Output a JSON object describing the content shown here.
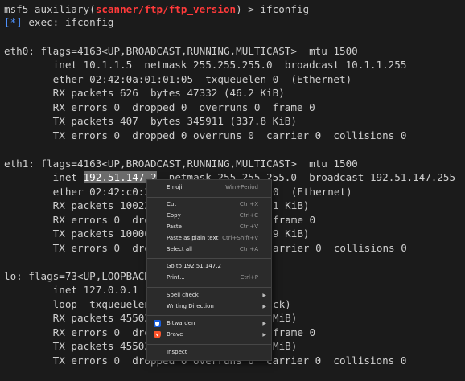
{
  "terminal": {
    "prompt_prefix": "msf5 auxiliary(",
    "module_path": "scanner/ftp/ftp_version",
    "prompt_suffix": ") > ifconfig",
    "exec_marker": "[*]",
    "exec_text": " exec: ifconfig",
    "eth0": {
      "l1": "eth0: flags=4163<UP,BROADCAST,RUNNING,MULTICAST>  mtu 1500",
      "l2": "        inet 10.1.1.5  netmask 255.255.255.0  broadcast 10.1.1.255",
      "l3": "        ether 02:42:0a:01:01:05  txqueuelen 0  (Ethernet)",
      "l4": "        RX packets 626  bytes 47332 (46.2 KiB)",
      "l5": "        RX errors 0  dropped 0  overruns 0  frame 0",
      "l6": "        TX packets 407  bytes 345911 (337.8 KiB)",
      "l7": "        TX errors 0  dropped 0 overruns 0  carrier 0  collisions 0"
    },
    "eth1": {
      "l1": "eth1: flags=4163<UP,BROADCAST,RUNNING,MULTICAST>  mtu 1500",
      "l2_pre": "        inet ",
      "l2_sel": "192.51.147.2",
      "l2_post": "  netmask 255.255.255.0  broadcast 192.51.147.255",
      "l3a": "        ether 02:42:c0:3",
      "l3b": "0  (Ethernet)",
      "l4a": "        RX packets 10022",
      "l4b": "1 KiB)",
      "l5a": "        RX errors 0  dro",
      "l5b": "frame 0",
      "l6a": "        TX packets 10006",
      "l6b": "9 KiB)",
      "l7a": "        TX errors 0  dro",
      "l7b": "arrier 0  collisions 0"
    },
    "lo": {
      "l1": "lo: flags=73<UP,LOOPBACK",
      "l2": "        inet 127.0.0.1",
      "l3a": "        loop  txqueuelen",
      "l3b": "ck)",
      "l4a": "        RX packets 45503",
      "l4b": "MiB)",
      "l5a": "        RX errors 0  dro",
      "l5b": "frame 0",
      "l6a": "        TX packets 45503",
      "l6b": "MiB)",
      "l7": "        TX errors 0  dropped 0 overruns 0  carrier 0  collisions 0"
    }
  },
  "context_menu": {
    "emoji": {
      "label": "Emoji",
      "shortcut": "Win+Period"
    },
    "cut": {
      "label": "Cut",
      "shortcut": "Ctrl+X"
    },
    "copy": {
      "label": "Copy",
      "shortcut": "Ctrl+C"
    },
    "paste": {
      "label": "Paste",
      "shortcut": "Ctrl+V"
    },
    "paste_plain": {
      "label": "Paste as plain text",
      "shortcut": "Ctrl+Shift+V"
    },
    "select_all": {
      "label": "Select all",
      "shortcut": "Ctrl+A"
    },
    "goto": {
      "label": "Go to 192.51.147.2"
    },
    "print": {
      "label": "Print...",
      "shortcut": "Ctrl+P"
    },
    "spell": {
      "label": "Spell check"
    },
    "writing": {
      "label": "Writing Direction"
    },
    "bitwarden": {
      "label": "Bitwarden"
    },
    "brave": {
      "label": "Brave"
    },
    "inspect": {
      "label": "Inspect"
    }
  },
  "icons": {
    "submenu_arrow": "chevron-right-icon",
    "bitwarden": "bitwarden-shield-icon",
    "brave": "brave-lion-icon"
  },
  "colors": {
    "background": "#1b1b1b",
    "text": "#cfcfcf",
    "prompt_module": "#ff3a3a",
    "exec_marker": "#4f93ff",
    "selection": "#6b6b6b",
    "menu_bg": "#2b2b2b"
  }
}
